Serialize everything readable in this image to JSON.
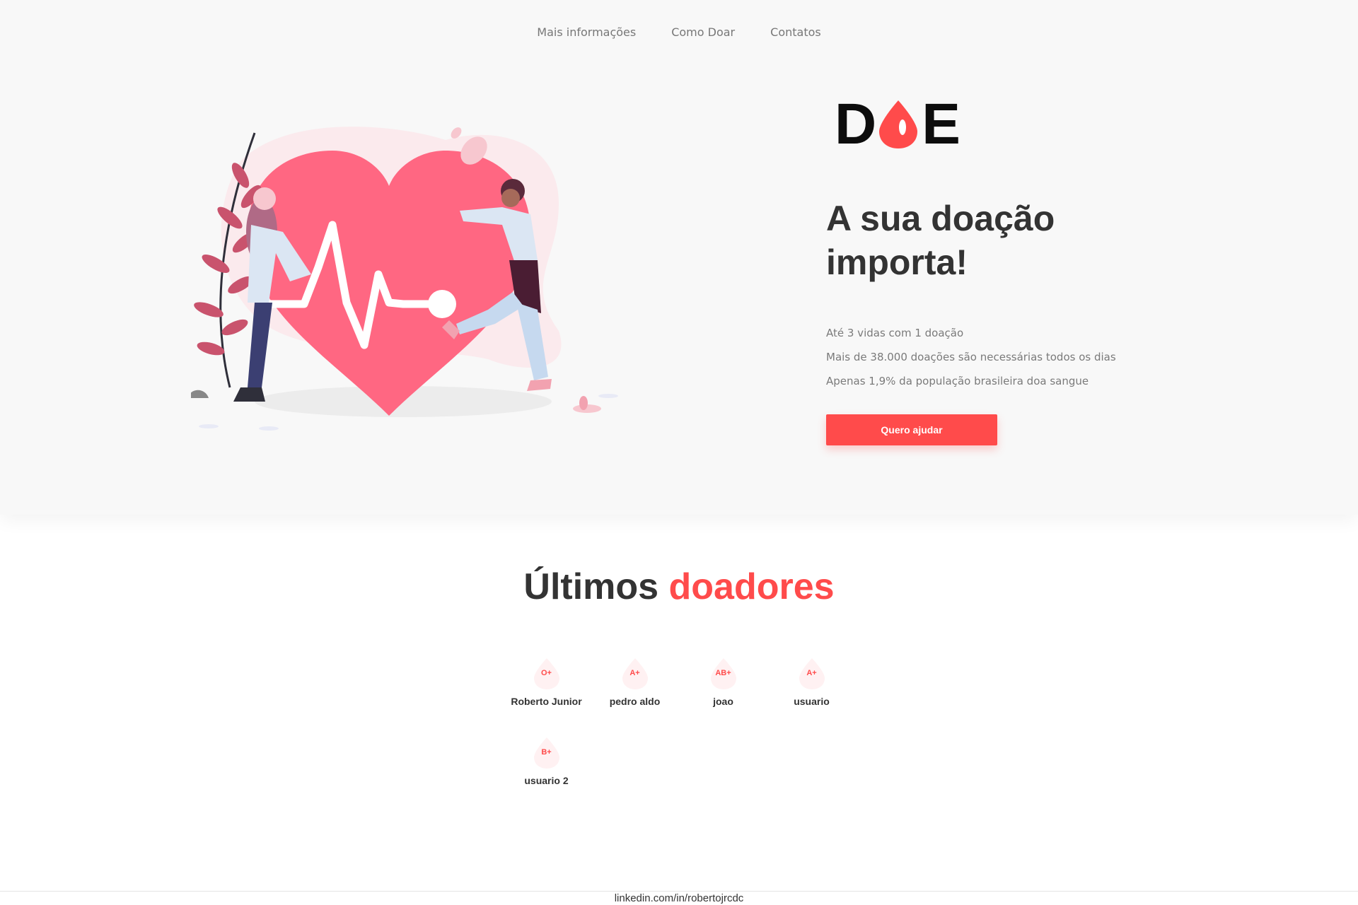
{
  "nav": {
    "items": [
      "Mais informações",
      "Como Doar",
      "Contatos"
    ]
  },
  "logo": {
    "left": "D",
    "right": "E"
  },
  "hero": {
    "headline": "A sua doação importa!",
    "facts": [
      "Até 3 vidas com 1 doação",
      "Mais de 38.000 doações são necessárias todos os dias",
      "Apenas 1,9% da população brasileira doa sangue"
    ],
    "cta": "Quero ajudar"
  },
  "donors": {
    "title_prefix": "Últimos",
    "title_accent": "doadores",
    "list": [
      {
        "name": "Roberto Junior",
        "blood": "O+"
      },
      {
        "name": "pedro aldo",
        "blood": "A+"
      },
      {
        "name": "joao",
        "blood": "AB+"
      },
      {
        "name": "usuario",
        "blood": "A+"
      },
      {
        "name": "usuario 2",
        "blood": "B+"
      }
    ]
  },
  "footer": {
    "text": "linkedin.com/in/robertojrcdc"
  },
  "colors": {
    "accent": "#ff4b4b",
    "heart": "#ff6782",
    "background": "#f8f8f8"
  }
}
